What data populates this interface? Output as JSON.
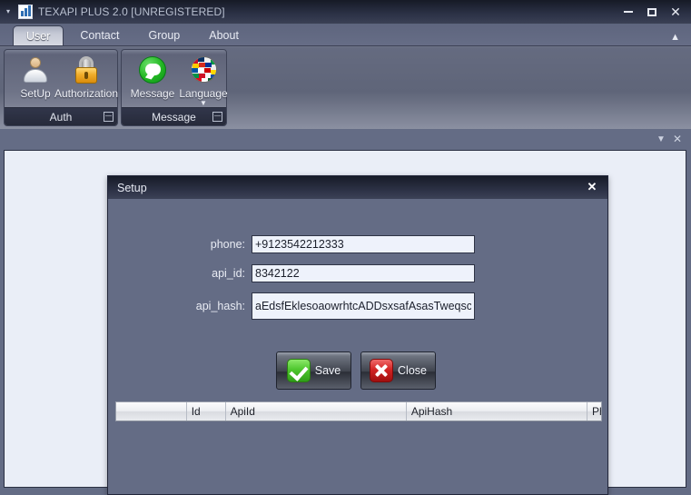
{
  "window": {
    "title": "TEXAPI PLUS 2.0 [UNREGISTERED]",
    "logo_icon": "app-logo-icon",
    "qat_arrow_icon": "quick-access-dropdown-icon",
    "minimize_label": "–",
    "maximize_label": "□",
    "close_label": "✕"
  },
  "ribbon": {
    "tabs": [
      {
        "label": "User",
        "active": true
      },
      {
        "label": "Contact",
        "active": false
      },
      {
        "label": "Group",
        "active": false
      },
      {
        "label": "About",
        "active": false
      }
    ],
    "collapse_icon": "chevron-up-icon",
    "groups": [
      {
        "name": "Auth",
        "launcher_icon": "dialog-launcher-icon",
        "items": [
          {
            "label": "SetUp",
            "icon": "person-icon",
            "has_caret": false
          },
          {
            "label": "Authorization",
            "icon": "lock-icon",
            "has_caret": false
          }
        ]
      },
      {
        "name": "Message",
        "launcher_icon": "dialog-launcher-icon",
        "items": [
          {
            "label": "Message",
            "icon": "speech-bubble-icon",
            "has_caret": false
          },
          {
            "label": "Language",
            "icon": "globe-flags-icon",
            "has_caret": true
          }
        ]
      }
    ]
  },
  "dockbar": {
    "filter_icon": "chevron-down-icon",
    "close_icon": "close-icon"
  },
  "dialog": {
    "title": "Setup",
    "close_label": "✕",
    "fields": [
      {
        "label": "phone:",
        "value": "+9123542212333",
        "placeholder": ""
      },
      {
        "label": "api_id:",
        "value": "8342122",
        "placeholder": ""
      },
      {
        "label": "api_hash:",
        "value": "aEdsfEklesoaowrhtcADDsxsafAsasTweqscw",
        "placeholder": ""
      }
    ],
    "buttons": [
      {
        "label": "Save",
        "icon": "green-check-icon"
      },
      {
        "label": "Close",
        "icon": "red-x-icon"
      }
    ],
    "grid": {
      "columns": [
        "",
        "Id",
        "ApiId",
        "ApiHash",
        "Ph"
      ],
      "rows": []
    }
  },
  "colors": {
    "app_background": "#646c85",
    "titlebar_dark": "#22263a",
    "client_area": "#eaeef7",
    "accent_green": "#2f9e18",
    "accent_red": "#a00f0f",
    "input_background": "#eef2fb"
  }
}
